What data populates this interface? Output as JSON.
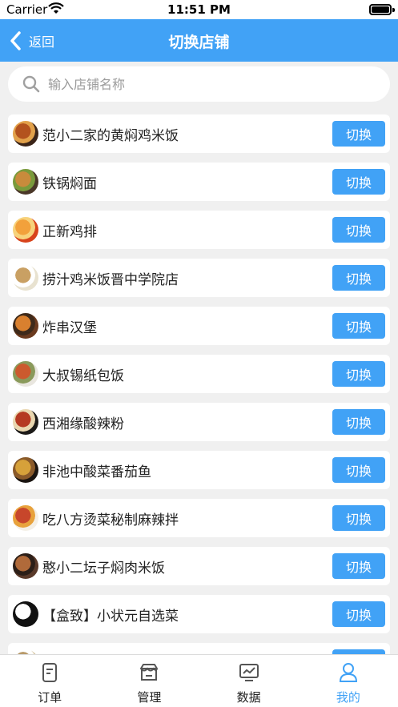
{
  "status_bar": {
    "carrier": "Carrier",
    "time": "11:51 PM"
  },
  "nav": {
    "back_label": "返回",
    "title": "切换店铺"
  },
  "search": {
    "placeholder": "输入店铺名称"
  },
  "stores": [
    {
      "name": "范小二家的黄焖鸡米饭",
      "button": "切换",
      "avatar_colors": [
        "#3b2418",
        "#b3521e",
        "#e2a14a"
      ]
    },
    {
      "name": "铁锅焖面",
      "button": "切换",
      "avatar_colors": [
        "#4a3728",
        "#c98b3c",
        "#7a9a3b"
      ]
    },
    {
      "name": "正新鸡排",
      "button": "切换",
      "avatar_colors": [
        "#d8431b",
        "#f2a13b",
        "#f7d27b"
      ]
    },
    {
      "name": "捞汁鸡米饭晋中学院店",
      "button": "切换",
      "avatar_colors": [
        "#e8e2d0",
        "#c9a063",
        "#ffffff"
      ]
    },
    {
      "name": "炸串汉堡",
      "button": "切换",
      "avatar_colors": [
        "#6b3a1e",
        "#d9802f",
        "#3f2a1a"
      ]
    },
    {
      "name": "大叔锡纸包饭",
      "button": "切换",
      "avatar_colors": [
        "#e9e6df",
        "#cc5a2e",
        "#8a9a5b"
      ]
    },
    {
      "name": "西湘缘酸辣粉",
      "button": "切换",
      "avatar_colors": [
        "#1c1a18",
        "#b53a22",
        "#e9d7b0"
      ]
    },
    {
      "name": "非池中酸菜番茄鱼",
      "button": "切换",
      "avatar_colors": [
        "#1a1410",
        "#d6a13a",
        "#8a5a2a"
      ]
    },
    {
      "name": "吃八方烫菜秘制麻辣拌",
      "button": "切换",
      "avatar_colors": [
        "#f4efe6",
        "#c7462b",
        "#e8a23c"
      ]
    },
    {
      "name": "憨小二坛子焖肉米饭",
      "button": "切换",
      "avatar_colors": [
        "#5a3a2a",
        "#b06a3a",
        "#2c1f18"
      ]
    },
    {
      "name": "【盒致】小状元自选菜",
      "button": "切换",
      "avatar_colors": [
        "#111111",
        "#ffffff",
        "#111111"
      ]
    },
    {
      "name": "",
      "button": "",
      "avatar_colors": [
        "#d8c9a8",
        "#b89a6a",
        "#ffffff"
      ]
    }
  ],
  "tabs": [
    {
      "label": "订单",
      "icon": "order-icon",
      "active": false
    },
    {
      "label": "管理",
      "icon": "store-icon",
      "active": false
    },
    {
      "label": "数据",
      "icon": "chart-icon",
      "active": false
    },
    {
      "label": "我的",
      "icon": "profile-icon",
      "active": true
    }
  ],
  "colors": {
    "accent": "#41a2f6",
    "background": "#f0f0f0"
  }
}
